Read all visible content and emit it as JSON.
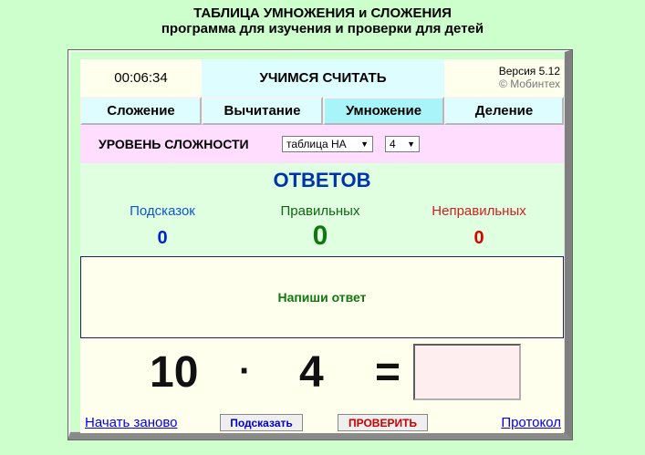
{
  "header": {
    "title": "ТАБЛИЦА УМНОЖЕНИЯ и СЛОЖЕНИЯ",
    "subtitle": "программа для изучения и проверки для детей"
  },
  "top": {
    "timer": "00:06:34",
    "app_title": "УЧИМСЯ СЧИТАТЬ",
    "version": "Версия 5.12",
    "copyright": "© Мобинтех"
  },
  "tabs": [
    {
      "label": "Сложение",
      "active": false
    },
    {
      "label": "Вычитание",
      "active": false
    },
    {
      "label": "Умножение",
      "active": true
    },
    {
      "label": "Деление",
      "active": false
    }
  ],
  "difficulty": {
    "label": "УРОВЕНЬ СЛОЖНОСТИ",
    "mode_selected": "таблица НА",
    "number_selected": "4"
  },
  "answers": {
    "title": "ОТВЕТОВ",
    "hints_label": "Подсказок",
    "hints_value": "0",
    "correct_label": "Правильных",
    "correct_value": "0",
    "wrong_label": "Неправильных",
    "wrong_value": "0"
  },
  "message": "Напиши ответ",
  "equation": {
    "a": "10",
    "op": "·",
    "b": "4",
    "eq": "=",
    "answer": ""
  },
  "bottom": {
    "restart": "Начать заново",
    "hint": "Подсказать",
    "check": "ПРОВЕРИТЬ",
    "protocol": "Протокол"
  },
  "colors": {
    "page_bg": "#ccffcc",
    "active_tab": "#a8f4f8",
    "difficulty_bg": "#ffddff",
    "answer_box": "#ffeef0"
  }
}
